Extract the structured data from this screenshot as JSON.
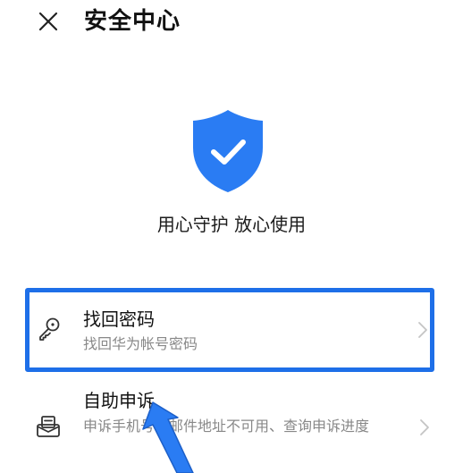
{
  "header": {
    "title": "安全中心",
    "close_icon": "close-icon"
  },
  "hero": {
    "icon": "shield-check-icon",
    "slogan": "用心守护 放心使用"
  },
  "items": [
    {
      "title": "找回密码",
      "subtitle": "找回华为帐号密码",
      "icon": "key-icon",
      "highlighted": true
    },
    {
      "title": "自助申诉",
      "subtitle": "申诉手机号或邮件地址不可用、查询申诉进度",
      "icon": "envelope-icon"
    }
  ],
  "colors": {
    "accent": "#2a7cf3",
    "highlight": "#1e6fe8",
    "subtitle": "#888888"
  }
}
